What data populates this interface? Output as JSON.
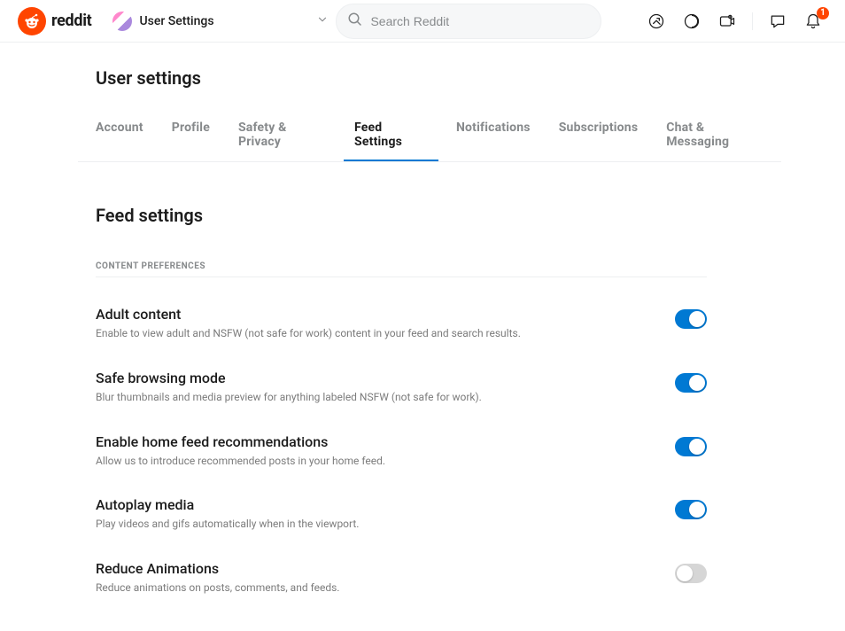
{
  "header": {
    "brand": "reddit",
    "community_label": "User Settings",
    "search_placeholder": "Search Reddit",
    "notification_count": "1"
  },
  "page": {
    "title": "User settings",
    "section_title": "Feed settings",
    "subheader": "Content Preferences"
  },
  "tabs": {
    "account": "Account",
    "profile": "Profile",
    "safety": "Safety & Privacy",
    "feed": "Feed Settings",
    "notifications": "Notifications",
    "subscriptions": "Subscriptions",
    "chat": "Chat & Messaging"
  },
  "settings": {
    "adult": {
      "title": "Adult content",
      "desc": "Enable to view adult and NSFW (not safe for work) content in your feed and search results."
    },
    "safe": {
      "title": "Safe browsing mode",
      "desc": "Blur thumbnails and media preview for anything labeled NSFW (not safe for work)."
    },
    "recs": {
      "title": "Enable home feed recommendations",
      "desc": "Allow us to introduce recommended posts in your home feed."
    },
    "autoplay": {
      "title": "Autoplay media",
      "desc": "Play videos and gifs automatically when in the viewport."
    },
    "reduce": {
      "title": "Reduce Animations",
      "desc": "Reduce animations on posts, comments, and feeds."
    }
  }
}
